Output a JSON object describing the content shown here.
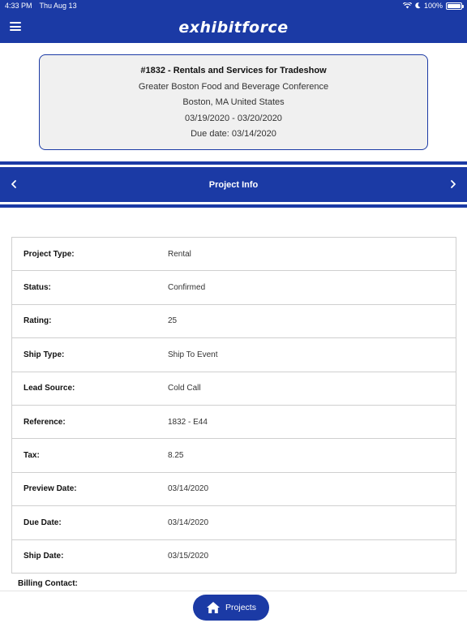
{
  "status_bar": {
    "time": "4:33 PM",
    "date": "Thu Aug 13",
    "battery": "100%"
  },
  "header": {
    "logo": "exhibitforce"
  },
  "project_summary": {
    "title": "#1832 - Rentals and Services for Tradeshow",
    "event": "Greater Boston Food and Beverage Conference",
    "location": "Boston, MA United States",
    "dates": "03/19/2020 - 03/20/2020",
    "due": "Due date: 03/14/2020"
  },
  "section_nav": {
    "title": "Project Info"
  },
  "details": [
    {
      "label": "Project Type:",
      "value": "Rental"
    },
    {
      "label": "Status:",
      "value": "Confirmed"
    },
    {
      "label": "Rating:",
      "value": "25"
    },
    {
      "label": "Ship Type:",
      "value": "Ship To Event"
    },
    {
      "label": "Lead Source:",
      "value": "Cold Call"
    },
    {
      "label": "Reference:",
      "value": "1832 - E44"
    },
    {
      "label": "Tax:",
      "value": "8.25"
    },
    {
      "label": "Preview Date:",
      "value": "03/14/2020"
    },
    {
      "label": "Due Date:",
      "value": "03/14/2020"
    },
    {
      "label": "Ship Date:",
      "value": "03/15/2020"
    }
  ],
  "billing_contact_label": "Billing Contact:",
  "footer": {
    "projects_label": "Projects"
  },
  "colors": {
    "brand": "#1b3aa5",
    "card_bg": "#f0f0f0"
  }
}
